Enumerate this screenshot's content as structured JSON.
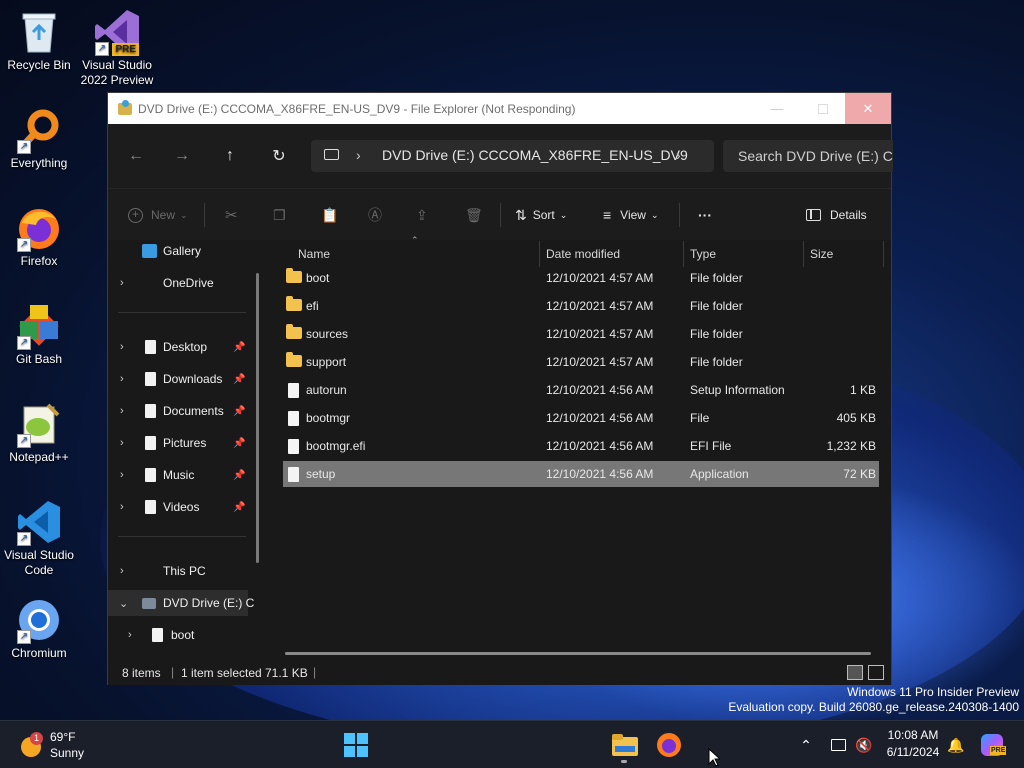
{
  "desktop": {
    "icons": [
      {
        "label": "Recycle Bin",
        "icon": "recycle-bin-icon"
      },
      {
        "label": "Visual Studio 2022 Preview",
        "line1": "Visual Studio",
        "line2": "2022 Preview",
        "badge": "PRE",
        "icon": "visual-studio-icon"
      },
      {
        "label": "Everything",
        "icon": "everything-search-icon"
      },
      {
        "label": "Firefox",
        "icon": "firefox-icon"
      },
      {
        "label": "Git Bash",
        "icon": "git-bash-icon"
      },
      {
        "label": "Notepad++",
        "icon": "notepad-plus-plus-icon"
      },
      {
        "label": "Visual Studio Code",
        "line1": "Visual Studio",
        "line2": "Code",
        "icon": "vscode-icon"
      },
      {
        "label": "Chromium",
        "icon": "chromium-icon"
      }
    ],
    "watermark": {
      "line1": "Windows 11 Pro Insider Preview",
      "line2": "Evaluation copy. Build 26080.ge_release.240308-1400"
    }
  },
  "explorer": {
    "title": "DVD Drive (E:) CCCOMA_X86FRE_EN-US_DV9 - File Explorer (Not Responding)",
    "address": {
      "location": "DVD Drive (E:) CCCOMA_X86FRE_EN-US_DV9",
      "separator": "›"
    },
    "search": {
      "placeholder": "Search DVD Drive (E:) CCC"
    },
    "toolbar": {
      "new_label": "New",
      "sort_label": "Sort",
      "view_label": "View",
      "more_label": "···",
      "details_label": "Details"
    },
    "sidebar": {
      "gallery": "Gallery",
      "onedrive": "OneDrive",
      "quick_access": [
        {
          "label": "Desktop"
        },
        {
          "label": "Downloads"
        },
        {
          "label": "Documents"
        },
        {
          "label": "Pictures"
        },
        {
          "label": "Music"
        },
        {
          "label": "Videos"
        }
      ],
      "this_pc": "This PC",
      "dvd_drive": "DVD Drive (E:) C",
      "boot": "boot"
    },
    "columns": {
      "name": "Name",
      "date": "Date modified",
      "type": "Type",
      "size": "Size"
    },
    "files": [
      {
        "name": "boot",
        "date": "12/10/2021 4:57 AM",
        "type": "File folder",
        "size": "",
        "kind": "folder"
      },
      {
        "name": "efi",
        "date": "12/10/2021 4:57 AM",
        "type": "File folder",
        "size": "",
        "kind": "folder"
      },
      {
        "name": "sources",
        "date": "12/10/2021 4:57 AM",
        "type": "File folder",
        "size": "",
        "kind": "folder"
      },
      {
        "name": "support",
        "date": "12/10/2021 4:57 AM",
        "type": "File folder",
        "size": "",
        "kind": "folder"
      },
      {
        "name": "autorun",
        "date": "12/10/2021 4:56 AM",
        "type": "Setup Information",
        "size": "1 KB",
        "kind": "file"
      },
      {
        "name": "bootmgr",
        "date": "12/10/2021 4:56 AM",
        "type": "File",
        "size": "405 KB",
        "kind": "file"
      },
      {
        "name": "bootmgr.efi",
        "date": "12/10/2021 4:56 AM",
        "type": "EFI File",
        "size": "1,232 KB",
        "kind": "file"
      },
      {
        "name": "setup",
        "date": "12/10/2021 4:56 AM",
        "type": "Application",
        "size": "72 KB",
        "kind": "file",
        "selected": true
      }
    ],
    "status": {
      "items": "8 items",
      "selected": "1 item selected",
      "size": "71.1 KB"
    }
  },
  "taskbar": {
    "weather": {
      "temp": "69°F",
      "condition": "Sunny",
      "alert_badge": "1"
    },
    "clock": {
      "time": "10:08 AM",
      "date": "6/11/2024"
    },
    "copilot_badge": "PRE"
  }
}
